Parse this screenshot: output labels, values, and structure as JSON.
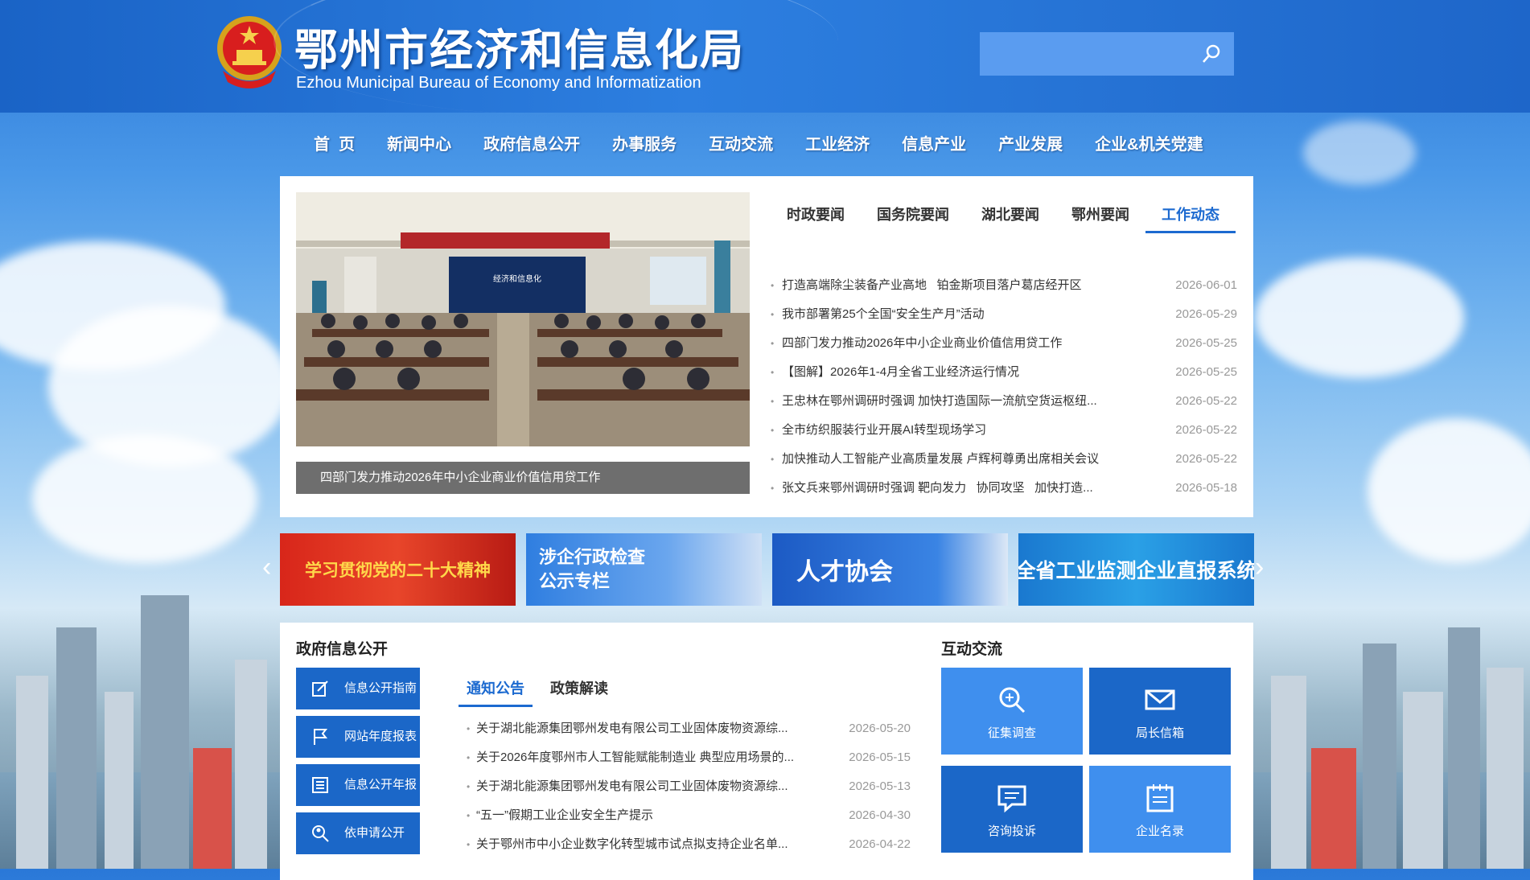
{
  "header": {
    "title": "鄂州市经济和信息化局",
    "subtitle": "Ezhou Municipal Bureau of Economy and Informatization",
    "search_placeholder": ""
  },
  "nav": [
    {
      "label": "首  页"
    },
    {
      "label": "新闻中心"
    },
    {
      "label": "政府信息公开"
    },
    {
      "label": "办事服务"
    },
    {
      "label": "互动交流"
    },
    {
      "label": "工业经济"
    },
    {
      "label": "信息产业"
    },
    {
      "label": "产业发展"
    },
    {
      "label": "企业&机关党建"
    }
  ],
  "news": {
    "image_caption": "四部门发力推动2026年中小企业商业价值信用贷工作",
    "image_banner_text": "经济和信息化",
    "tabs": [
      {
        "label": "时政要闻",
        "active": false
      },
      {
        "label": "国务院要闻",
        "active": false
      },
      {
        "label": "湖北要闻",
        "active": false
      },
      {
        "label": "鄂州要闻",
        "active": false
      },
      {
        "label": "工作动态",
        "active": true
      }
    ],
    "items": [
      {
        "title": "打造高端除尘装备产业高地   铂金斯项目落户葛店经开区",
        "date": "2026-06-01"
      },
      {
        "title": "我市部署第25个全国“安全生产月”活动",
        "date": "2026-05-29"
      },
      {
        "title": "四部门发力推动2026年中小企业商业价值信用贷工作",
        "date": "2026-05-25"
      },
      {
        "title": "【图解】2026年1-4月全省工业经济运行情况",
        "date": "2026-05-25"
      },
      {
        "title": "王忠林在鄂州调研时强调 加快打造国际一流航空货运枢纽...",
        "date": "2026-05-22"
      },
      {
        "title": "全市纺织服装行业开展AI转型现场学习",
        "date": "2026-05-22"
      },
      {
        "title": "加快推动人工智能产业高质量发展 卢辉柯尊勇出席相关会议",
        "date": "2026-05-22"
      },
      {
        "title": "张文兵来鄂州调研时强调 靶向发力   协同攻坚   加快打造...",
        "date": "2026-05-18"
      }
    ]
  },
  "banners": [
    {
      "text": "学习贯彻党的二十大精神",
      "bg": "#c8201a"
    },
    {
      "text": "涉企行政检查\n公示专栏",
      "bg": "#2f7ee0"
    },
    {
      "text": "人才协会",
      "bg": "#1d5fc8"
    },
    {
      "text": "全省工业监测企业直报系统",
      "bg": "#1f8ad8"
    }
  ],
  "gov": {
    "title": "政府信息公开",
    "side_buttons": [
      {
        "label": "信息公开指南",
        "icon": "edit-icon"
      },
      {
        "label": "网站年度报表",
        "icon": "flag-icon"
      },
      {
        "label": "信息公开年报",
        "icon": "document-icon"
      },
      {
        "label": "依申请公开",
        "icon": "search-person-icon"
      }
    ],
    "tabs": [
      {
        "label": "通知公告",
        "active": true
      },
      {
        "label": "政策解读",
        "active": false
      }
    ],
    "items": [
      {
        "title": "关于湖北能源集团鄂州发电有限公司工业固体废物资源综...",
        "date": "2026-05-20"
      },
      {
        "title": "关于2026年度鄂州市人工智能赋能制造业 典型应用场景的...",
        "date": "2026-05-15"
      },
      {
        "title": "关于湖北能源集团鄂州发电有限公司工业固体废物资源综...",
        "date": "2026-05-13"
      },
      {
        "title": "“五一”假期工业企业安全生产提示",
        "date": "2026-04-30"
      },
      {
        "title": "关于鄂州市中小企业数字化转型城市试点拟支持企业名单...",
        "date": "2026-04-22"
      }
    ]
  },
  "interact": {
    "title": "互动交流",
    "tiles": [
      {
        "label": "征集调查",
        "icon": "magnifier-icon",
        "bg": "#3f8fee"
      },
      {
        "label": "局长信箱",
        "icon": "mail-icon",
        "bg": "#1b67c8"
      },
      {
        "label": "咨询投诉",
        "icon": "chat-icon",
        "bg": "#1b67c8"
      },
      {
        "label": "企业名录",
        "icon": "notebook-icon",
        "bg": "#3f8fee"
      }
    ]
  },
  "colors": {
    "primary": "#1b67c8",
    "accent": "#1c6ad0"
  }
}
